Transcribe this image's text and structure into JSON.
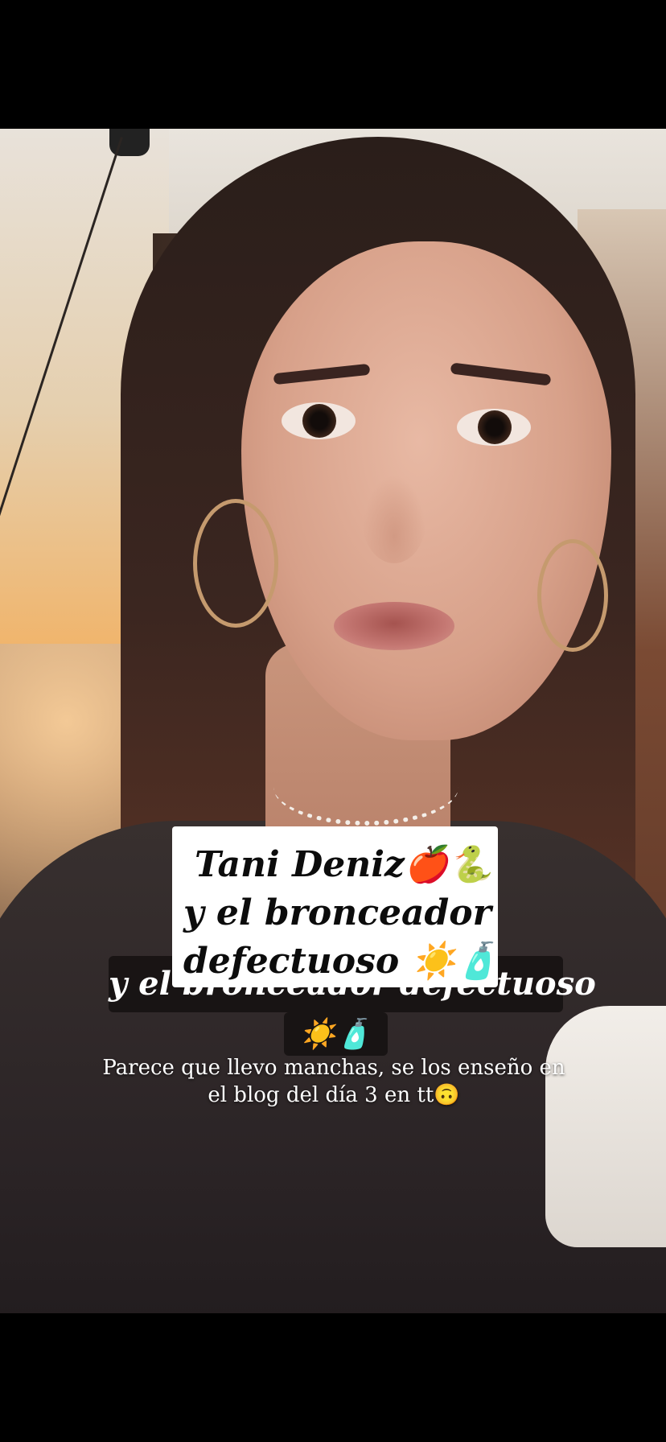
{
  "video": {
    "overlay_caption": {
      "line1": "y el bronceador defectuoso",
      "line2": "☀️🧴"
    },
    "subcaption": {
      "line1": "Parece que llevo manchas, se los enseño en",
      "line2": "el blog del día 3 en tt🙃"
    },
    "title_card": {
      "line1": "Tani Deniz🍎🐍",
      "line2": "y el bronceador",
      "line3": "defectuoso ☀️🧴"
    }
  }
}
